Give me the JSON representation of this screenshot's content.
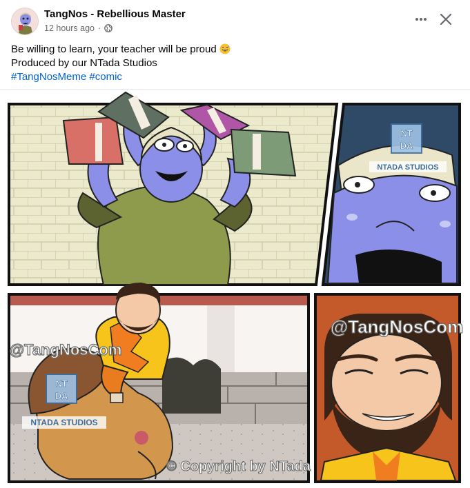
{
  "post": {
    "author": "TangNos - Rebellious Master",
    "time": "12 hours ago",
    "separator": "·",
    "caption": {
      "line1": "Be willing to learn, your teacher will be proud",
      "line2": "Produced by our NTada Studios",
      "hashtags": [
        "#TangNosMeme",
        "#comic"
      ]
    }
  },
  "icons": {
    "privacy": "globe-icon",
    "more": "more-horizontal-icon",
    "close": "close-icon",
    "emoji": "grinning-sweat-emoji"
  },
  "comic": {
    "watermarks": {
      "studio_logo_top": "NT DA",
      "studio_name": "NTADA STUDIOS",
      "handle": "@TangNosCom",
      "copyright": "© Copyright by NTada Studios"
    }
  },
  "colors": {
    "hashtag": "#0064d1",
    "secondary_text": "#65676b",
    "divider": "#e4e6eb"
  }
}
